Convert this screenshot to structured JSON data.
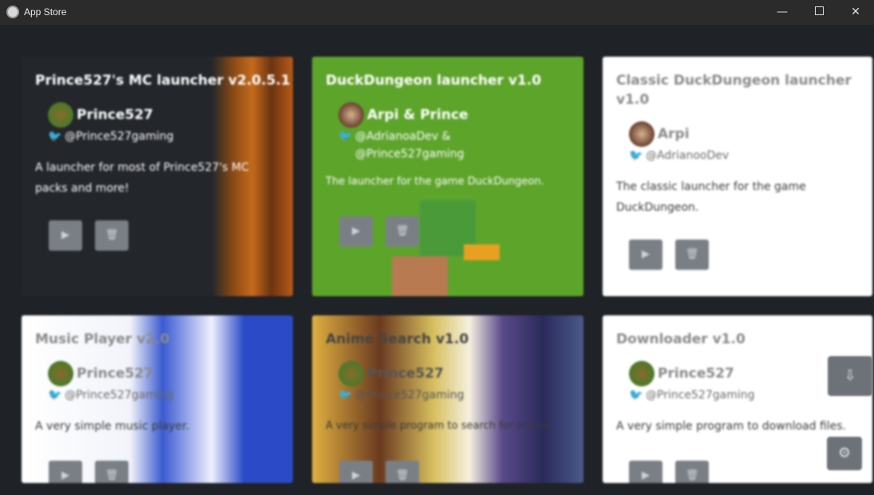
{
  "window": {
    "title": "App Store",
    "minimize_glyph": "—",
    "close_glyph": "✕"
  },
  "cards": [
    {
      "title": "Prince527's MC launcher v2.0.5.1",
      "author": "Prince527",
      "handle": "@Prince527gaming",
      "description": "A launcher for most of Prince527's MC packs and more!"
    },
    {
      "title": "DuckDungeon launcher v1.0",
      "author": "Arpi & Prince",
      "handle": "@AdrianoaDev & @Prince527gaming",
      "description": "The launcher for the game DuckDungeon."
    },
    {
      "title": "Classic DuckDungeon launcher v1.0",
      "author": "Arpi",
      "handle": "@AdrianooDev",
      "description": "The classic launcher for the game DuckDungeon."
    },
    {
      "title": "Music Player v2.0",
      "author": "Prince527",
      "handle": "@Prince527gaming",
      "description": "A very simple music player."
    },
    {
      "title": "Anime Search v1.0",
      "author": "Prince527",
      "handle": "@Prince527gaming",
      "description": "A very simple program to search for anime."
    },
    {
      "title": "Downloader v1.0",
      "author": "Prince527",
      "handle": "@Prince527gaming",
      "description": "A very simple program to download files."
    }
  ],
  "icons": {
    "play": "play-icon",
    "delete": "trash-icon",
    "download": "download-icon",
    "settings": "gear-icon"
  },
  "colors": {
    "background": "#1f2227",
    "card_dark": "#23262b",
    "card_green": "#5da42b",
    "card_white": "#ffffff",
    "button": "#7a7f86"
  }
}
